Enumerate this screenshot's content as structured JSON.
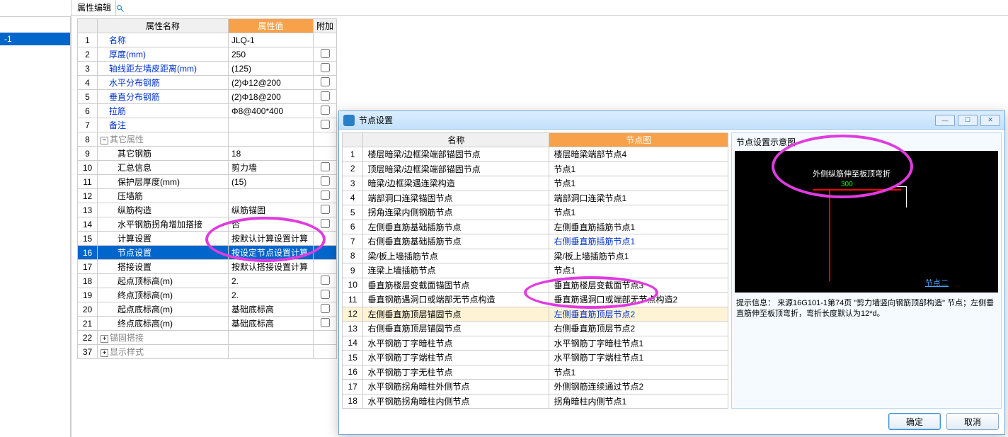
{
  "sidebar": {
    "search_placeholder": "",
    "item_label": "-1"
  },
  "main": {
    "title": "属性编辑",
    "headers": {
      "name": "属性名称",
      "value": "属性值",
      "extra": "附加"
    },
    "groups": {
      "other": "其它属性",
      "anchor": "锚固搭接",
      "display": "显示样式"
    },
    "rows": [
      {
        "n": "1",
        "name": "名称",
        "value": "JLQ-1",
        "blue": true
      },
      {
        "n": "2",
        "name": "厚度(mm)",
        "value": "250",
        "blue": true,
        "chk": true
      },
      {
        "n": "3",
        "name": "轴线距左墙皮距离(mm)",
        "value": "(125)",
        "blue": true,
        "chk": true
      },
      {
        "n": "4",
        "name": "水平分布钢筋",
        "value": "(2)Φ12@200",
        "blue": true,
        "chk": true
      },
      {
        "n": "5",
        "name": "垂直分布钢筋",
        "value": "(2)Φ18@200",
        "blue": true,
        "chk": true
      },
      {
        "n": "6",
        "name": "拉筋",
        "value": "Φ8@400*400",
        "blue": true,
        "chk": true
      },
      {
        "n": "7",
        "name": "备注",
        "value": "",
        "blue": true,
        "chk": true
      },
      {
        "n": "9",
        "name": "其它钢筋",
        "value": "18",
        "indent": 2
      },
      {
        "n": "10",
        "name": "汇总信息",
        "value": "剪力墙",
        "indent": 2,
        "chk": true
      },
      {
        "n": "11",
        "name": "保护层厚度(mm)",
        "value": "(15)",
        "indent": 2,
        "chk": true
      },
      {
        "n": "12",
        "name": "压墙筋",
        "value": "",
        "indent": 2,
        "chk": true
      },
      {
        "n": "13",
        "name": "纵筋构造",
        "value": "纵筋锚固",
        "indent": 2,
        "chk": true
      },
      {
        "n": "14",
        "name": "水平钢筋拐角增加搭接",
        "value": "否",
        "indent": 2,
        "chk": true
      },
      {
        "n": "15",
        "name": "计算设置",
        "value": "按默认计算设置计算",
        "indent": 2
      },
      {
        "n": "16",
        "name": "节点设置",
        "value": "按设定节点设置计算",
        "indent": 2,
        "selected": true
      },
      {
        "n": "17",
        "name": "搭接设置",
        "value": "按默认搭接设置计算",
        "indent": 2
      },
      {
        "n": "18",
        "name": "起点顶标高(m)",
        "value": "2.",
        "indent": 2,
        "chk": true
      },
      {
        "n": "19",
        "name": "终点顶标高(m)",
        "value": "2.",
        "indent": 2,
        "chk": true
      },
      {
        "n": "20",
        "name": "起点底标高(m)",
        "value": "基础底标高",
        "indent": 2,
        "chk": true
      },
      {
        "n": "21",
        "name": "终点底标高(m)",
        "value": "基础底标高",
        "indent": 2,
        "chk": true
      }
    ]
  },
  "dialog": {
    "title": "节点设置",
    "headers": {
      "name": "名称",
      "image": "节点图"
    },
    "rows": [
      {
        "n": "1",
        "name": "楼层暗梁/边框梁端部锚固节点",
        "img": "楼层暗梁端部节点4"
      },
      {
        "n": "2",
        "name": "顶层暗梁/边框梁端部锚固节点",
        "img": "节点1"
      },
      {
        "n": "3",
        "name": "暗梁/边框梁遇连梁构造",
        "img": "节点1"
      },
      {
        "n": "4",
        "name": "端部洞口连梁锚固节点",
        "img": "端部洞口连梁节点1"
      },
      {
        "n": "5",
        "name": "拐角连梁内侧钢筋节点",
        "img": "节点1"
      },
      {
        "n": "6",
        "name": "左侧垂直筋基础插筋节点",
        "img": "左侧垂直筋插筋节点1"
      },
      {
        "n": "7",
        "name": "右侧垂直筋基础插筋节点",
        "img": "右侧垂直筋插筋节点1",
        "link": true
      },
      {
        "n": "8",
        "name": "梁/板上墙插筋节点",
        "img": "梁/板上墙插筋节点1"
      },
      {
        "n": "9",
        "name": "连梁上墙插筋节点",
        "img": "节点1"
      },
      {
        "n": "10",
        "name": "垂直筋楼层变截面锚固节点",
        "img": "垂直筋楼层变截面节点3"
      },
      {
        "n": "11",
        "name": "垂直钢筋遇洞口或端部无节点构造",
        "img": "垂直筋遇洞口或端部无节点构造2"
      },
      {
        "n": "12",
        "name": "左侧垂直筋顶层锚固节点",
        "img": "左侧垂直筋顶层节点2",
        "sel": true,
        "link": true
      },
      {
        "n": "13",
        "name": "右侧垂直筋顶层锚固节点",
        "img": "右侧垂直筋顶层节点2"
      },
      {
        "n": "14",
        "name": "水平钢筋丁字暗柱节点",
        "img": "水平钢筋丁字暗柱节点1"
      },
      {
        "n": "15",
        "name": "水平钢筋丁字端柱节点",
        "img": "水平钢筋丁字端柱节点1"
      },
      {
        "n": "16",
        "name": "水平钢筋丁字无柱节点",
        "img": "节点1"
      },
      {
        "n": "17",
        "name": "水平钢筋拐角暗柱外侧节点",
        "img": "外侧钢筋连续通过节点2"
      },
      {
        "n": "18",
        "name": "水平钢筋拐角暗柱内侧节点",
        "img": "拐角暗柱内侧节点1"
      }
    ],
    "preview": {
      "title": "节点设置示意图",
      "text1": "外侧纵筋伸至板顶弯折",
      "dim": "300",
      "caption": "节点二",
      "hint_label": "提示信息：",
      "hint": "来源16G101-1第74页 \"剪力墙竖向钢筋顶部构造\" 节点；左侧垂直筋伸至板顶弯折，弯折长度默认为12*d。"
    },
    "buttons": {
      "ok": "确定",
      "cancel": "取消"
    }
  }
}
